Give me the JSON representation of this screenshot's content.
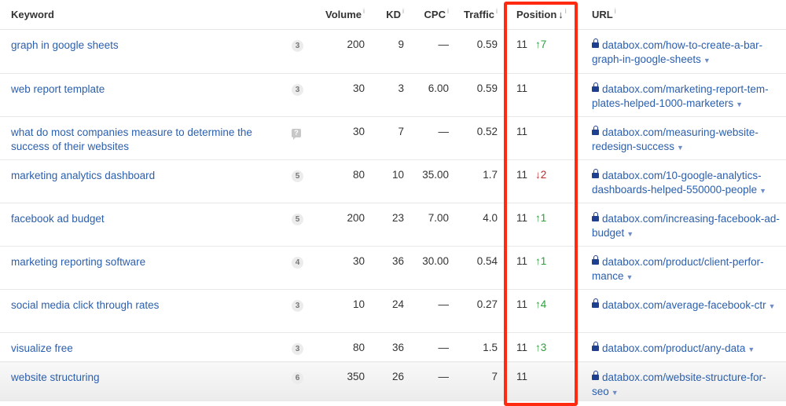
{
  "columns": {
    "keyword": "Keyword",
    "volume": "Volume",
    "kd": "KD",
    "cpc": "CPC",
    "traffic": "Traffic",
    "position": "Position",
    "position_sort": "↓",
    "url": "URL",
    "info": "i"
  },
  "colors": {
    "link": "#2b5fad",
    "up": "#2aa13a",
    "down": "#c62828",
    "highlight": "#ff2a10"
  },
  "rows": [
    {
      "keyword": "graph in google sheets",
      "serp": "3",
      "volume": "200",
      "kd": "9",
      "cpc": "—",
      "traffic": "0.59",
      "position": "11",
      "change_dir": "up",
      "change": "7",
      "url": "databox.com/how-to-create-a-bar-graph-in-google-sheets"
    },
    {
      "keyword": "web report template",
      "serp": "3",
      "volume": "30",
      "kd": "3",
      "cpc": "6.00",
      "traffic": "0.59",
      "position": "11",
      "change_dir": "",
      "change": "",
      "url": "databox.com/marketing-report-tem-plates-helped-1000-marketers"
    },
    {
      "keyword": "what do most companies measure to determine the success of their websites",
      "serp": "?",
      "volume": "30",
      "kd": "7",
      "cpc": "—",
      "traffic": "0.52",
      "position": "11",
      "change_dir": "",
      "change": "",
      "url": "databox.com/measuring-website-redesign-success"
    },
    {
      "keyword": "marketing analytics dashboard",
      "serp": "5",
      "volume": "80",
      "kd": "10",
      "cpc": "35.00",
      "traffic": "1.7",
      "position": "11",
      "change_dir": "down",
      "change": "2",
      "url": "databox.com/10-google-analytics-dashboards-helped-550000-people"
    },
    {
      "keyword": "facebook ad budget",
      "serp": "5",
      "volume": "200",
      "kd": "23",
      "cpc": "7.00",
      "traffic": "4.0",
      "position": "11",
      "change_dir": "up",
      "change": "1",
      "url": "databox.com/increasing-facebook-ad-budget"
    },
    {
      "keyword": "marketing reporting software",
      "serp": "4",
      "volume": "30",
      "kd": "36",
      "cpc": "30.00",
      "traffic": "0.54",
      "position": "11",
      "change_dir": "up",
      "change": "1",
      "url": "databox.com/product/client-perfor-mance"
    },
    {
      "keyword": "social media click through rates",
      "serp": "3",
      "volume": "10",
      "kd": "24",
      "cpc": "—",
      "traffic": "0.27",
      "position": "11",
      "change_dir": "up",
      "change": "4",
      "url": "databox.com/average-facebook-ctr"
    },
    {
      "keyword": "visualize free",
      "serp": "3",
      "volume": "80",
      "kd": "36",
      "cpc": "—",
      "traffic": "1.5",
      "position": "11",
      "change_dir": "up",
      "change": "3",
      "url": "databox.com/product/any-data"
    },
    {
      "keyword": "website structuring",
      "serp": "6",
      "volume": "350",
      "kd": "26",
      "cpc": "—",
      "traffic": "7",
      "position": "11",
      "change_dir": "",
      "change": "",
      "url": "databox.com/website-structure-for-seo"
    }
  ]
}
